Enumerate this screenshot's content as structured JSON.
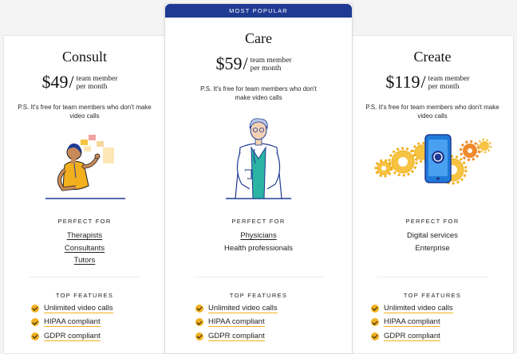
{
  "colors": {
    "accent": "#1f3a93",
    "highlight": "#f2b01e",
    "background": "#f4f4f4"
  },
  "plans": [
    {
      "name": "Consult",
      "price": "$49",
      "unit": "team member per month",
      "note": "P.S. It's free for team members who don't make video calls",
      "illustration": "consultant-woman-illustration",
      "perfect_for_label": "PERFECT FOR",
      "perfect_for": [
        "Therapists",
        "Consultants",
        "Tutors"
      ],
      "features_label": "TOP FEATURES",
      "features": [
        "Unlimited video calls",
        "HIPAA compliant",
        "GDPR compliant"
      ]
    },
    {
      "badge": "MOST POPULAR",
      "name": "Care",
      "price": "$59",
      "unit": "team member per month",
      "note": "P.S. It's free for team members who don't make video calls",
      "illustration": "doctor-illustration",
      "perfect_for_label": "PERFECT FOR",
      "perfect_for": [
        "Physicians",
        "Health professionals"
      ],
      "features_label": "TOP FEATURES",
      "features": [
        "Unlimited video calls",
        "HIPAA compliant",
        "GDPR compliant"
      ]
    },
    {
      "name": "Create",
      "price": "$119",
      "unit": "team member per month",
      "note": "P.S. It's free for team members who don't make video calls",
      "illustration": "phone-gears-illustration",
      "perfect_for_label": "PERFECT FOR",
      "perfect_for": [
        "Digital services",
        "Enterprise"
      ],
      "features_label": "TOP FEATURES",
      "features": [
        "Unlimited video calls",
        "HIPAA compliant",
        "GDPR compliant"
      ]
    }
  ]
}
